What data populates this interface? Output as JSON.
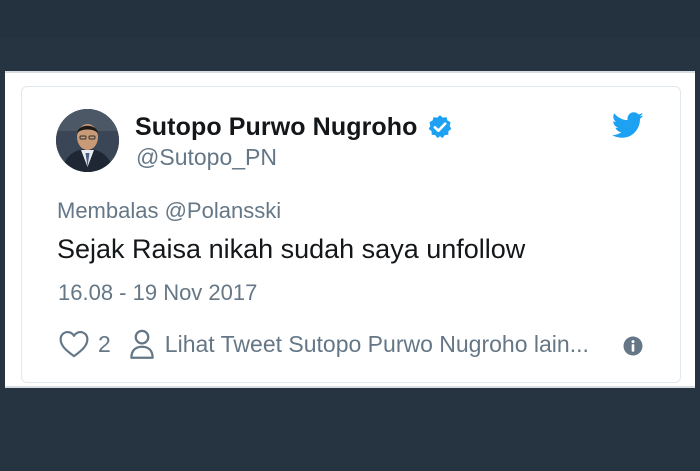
{
  "tweet": {
    "author_name": "Sutopo Purwo Nugroho",
    "handle": "@Sutopo_PN",
    "reply_to": "Membalas @Polansski",
    "text": "Sejak Raisa nikah sudah saya unfollow",
    "timestamp": "16.08 - 19 Nov 2017",
    "like_count": "2",
    "more_tweets_link": "Lihat Tweet Sutopo Purwo Nugroho lain..."
  },
  "icons": {
    "verified": "verified-badge-icon",
    "platform": "twitter-bird-icon",
    "like": "heart-icon",
    "profile": "person-icon",
    "info": "info-icon"
  },
  "colors": {
    "background": "#263340",
    "brand_blue": "#1da1f2",
    "text_primary": "#14171a",
    "text_secondary": "#657786"
  }
}
